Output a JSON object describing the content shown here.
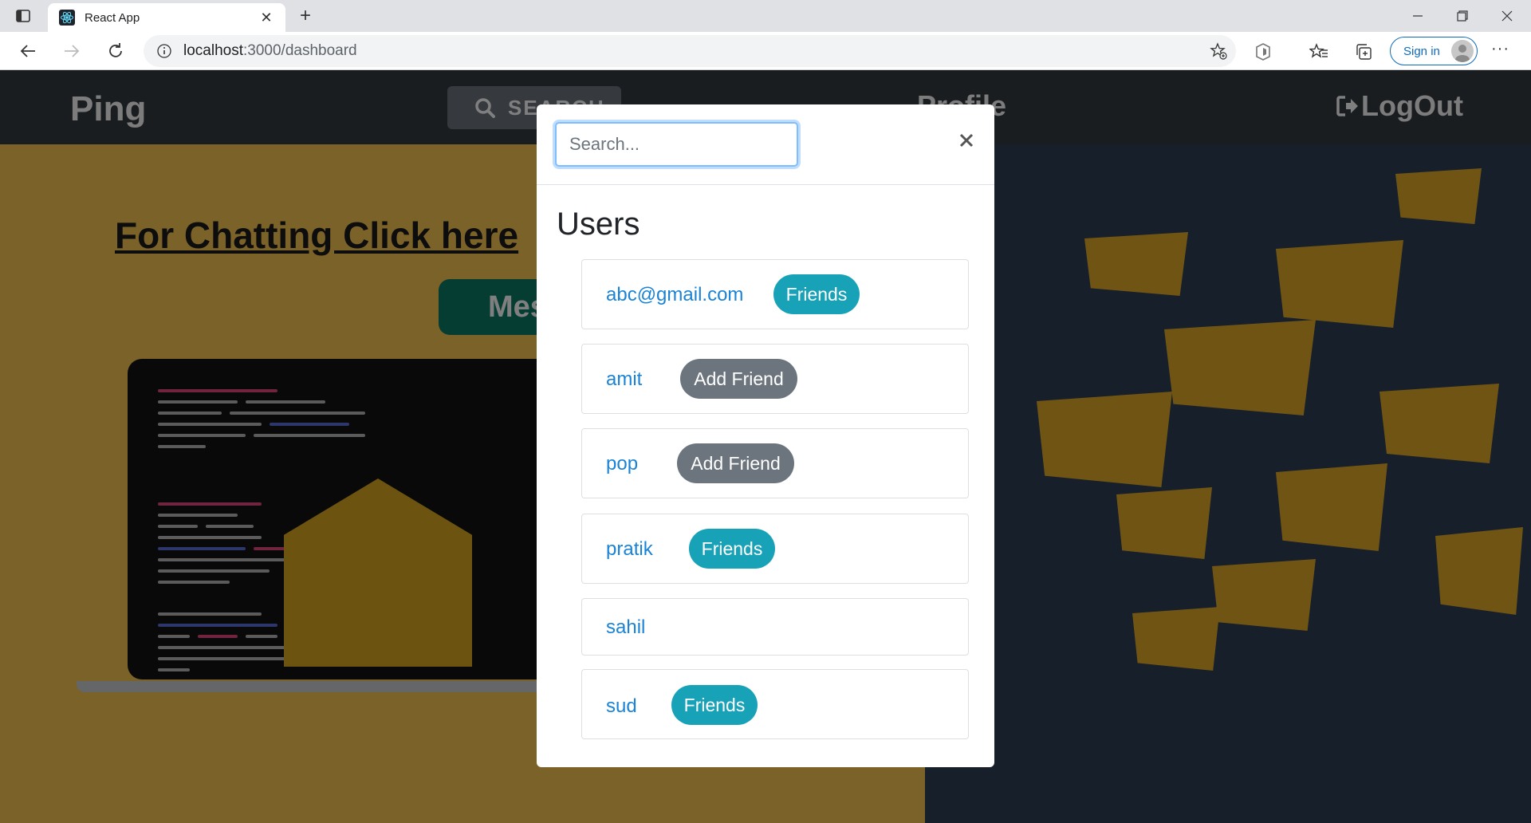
{
  "browser": {
    "tab_title": "React App",
    "url_host": "localhost",
    "url_path": ":3000/dashboard",
    "signin_label": "Sign in"
  },
  "app": {
    "brand": "Ping",
    "search_button": "SEARCH",
    "profile_link": "Profile",
    "logout_link": "LogOut",
    "chat_heading": "For Chatting Click here",
    "message_button": "Message"
  },
  "modal": {
    "search_placeholder": "Search...",
    "heading": "Users",
    "users": [
      {
        "name": "abc@gmail.com",
        "status": "Friends"
      },
      {
        "name": "amit",
        "status": "Add Friend"
      },
      {
        "name": "pop",
        "status": "Add Friend"
      },
      {
        "name": "pratik",
        "status": "Friends"
      },
      {
        "name": "sahil",
        "status": ""
      },
      {
        "name": "sud",
        "status": "Friends"
      }
    ]
  },
  "colors": {
    "friends_badge": "#17a2b8",
    "add_friend_badge": "#6c757d",
    "user_link": "#1a83d6",
    "navbar": "#343a40",
    "hero_yellow": "#f4c451",
    "hero_navy": "#2c3e55"
  },
  "icons": [
    "tab-sidebar-icon",
    "react-favicon-icon",
    "close-tab-icon",
    "new-tab-icon",
    "minimize-icon",
    "maximize-icon",
    "window-close-icon",
    "back-icon",
    "forward-icon",
    "refresh-icon",
    "info-icon",
    "add-favorite-icon",
    "extension-icon",
    "favorites-icon",
    "collections-icon",
    "profile-avatar-icon",
    "more-icon",
    "search-icon",
    "logout-icon",
    "modal-close-icon"
  ]
}
